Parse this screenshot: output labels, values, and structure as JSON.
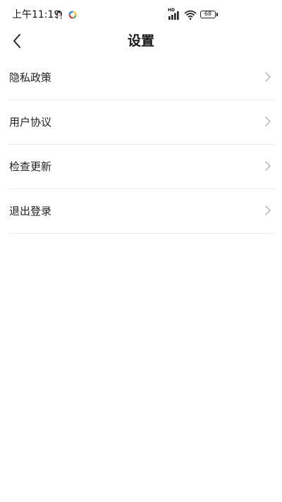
{
  "status_bar": {
    "time": "上午11:19",
    "network": "HD",
    "battery": "68"
  },
  "header": {
    "title": "设置"
  },
  "settings": {
    "items": [
      {
        "label": "隐私政策"
      },
      {
        "label": "用户协议"
      },
      {
        "label": "检查更新"
      },
      {
        "label": "退出登录"
      }
    ]
  }
}
